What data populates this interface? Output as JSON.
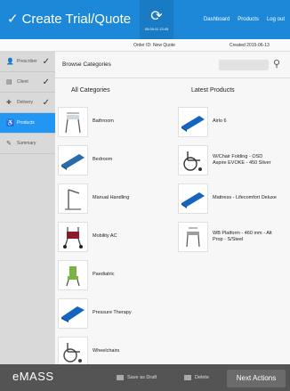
{
  "header": {
    "title": "Create Trial/Quote",
    "sync_time": "05:05:11 13:45",
    "links": [
      "Dashboard",
      "Products",
      "Log out"
    ]
  },
  "subheader": {
    "order_id": "Order ID: New Quote",
    "created": "Created 2015-06-13"
  },
  "sidebar": {
    "steps": [
      {
        "label": "Prescriber",
        "icon": "person-icon",
        "done": true
      },
      {
        "label": "Client",
        "icon": "id-card-icon",
        "done": true
      },
      {
        "label": "Delivery",
        "icon": "truck-icon",
        "done": true
      },
      {
        "label": "Products",
        "icon": "wheelchair-icon",
        "done": false,
        "active": true
      },
      {
        "label": "Summary",
        "icon": "clipboard-icon",
        "done": false
      }
    ]
  },
  "main": {
    "browse_label": "Browse Categories",
    "all_categories_title": "All Categories",
    "latest_products_title": "Latest Products",
    "categories": [
      "Bathroom",
      "Bedroom",
      "Manual Handling",
      "Mobility AC",
      "Paediatric",
      "Pressure Therapy",
      "Wheelchairs"
    ],
    "latest_products": [
      {
        "line1": "Airlo 6",
        "line2": ""
      },
      {
        "line1": "W/Chair Folding - OSD",
        "line2": "Aspire EVOKE - 450 Silver"
      },
      {
        "line1": "Mattress - Lifecomfort Deluxe",
        "line2": ""
      },
      {
        "line1": "WB Platform - 460 mm - Alt",
        "line2": "Prop - S/Steel"
      }
    ]
  },
  "footer": {
    "logo_main": "eMASS",
    "save_draft": "Save as Draft",
    "delete": "Delete",
    "next": "Next Actions"
  }
}
